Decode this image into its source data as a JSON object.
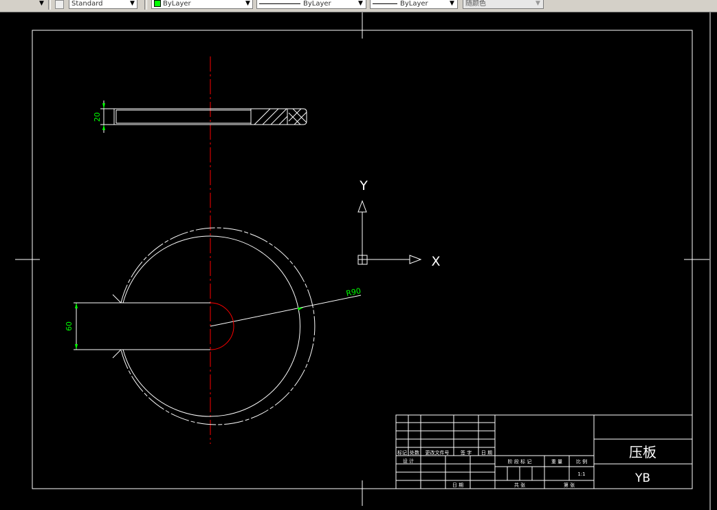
{
  "toolbar": {
    "text_style": "Standard",
    "layer": "ByLayer",
    "linetype": "ByLayer",
    "lineweight": "ByLayer",
    "plot_style": "随颜色",
    "colors": {
      "layer_swatch": "#00ff00"
    },
    "icons": [
      "dropdown-arrow-icon",
      "style-icon",
      "color-swatch-icon"
    ]
  },
  "drawing": {
    "dimensions": {
      "thickness": "20",
      "slot_width": "60",
      "radius": "R90"
    },
    "ucs": {
      "x_label": "X",
      "y_label": "Y"
    },
    "colors": {
      "background": "#000000",
      "lines": "#ffffff",
      "center_line": "#ff0000",
      "dimension_text": "#00ff00"
    }
  },
  "title_block": {
    "part_name": "压板",
    "part_code": "YB",
    "scale": "1:1",
    "headers": {
      "mark": "标记",
      "count": "处数",
      "change_doc": "更改文件号",
      "sign": "签 字",
      "date": "日 期",
      "design": "设 计",
      "stage_mark": "阶 段 标 记",
      "weight": "重 量",
      "ratio": "比 例",
      "total": "共 张",
      "sheet": "第 张",
      "date2": "日 期"
    }
  }
}
